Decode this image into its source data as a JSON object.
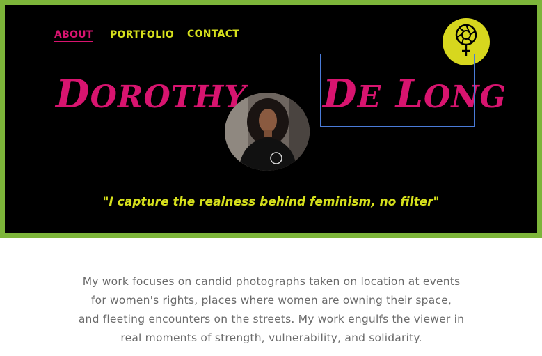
{
  "nav": {
    "about": "ABOUT",
    "portfolio": "PORTFOLIO",
    "contact": "CONTACT"
  },
  "hero": {
    "first_name_initial": "D",
    "first_name_rest": "OROTHY",
    "last_name_part1_initial": "D",
    "last_name_part1_rest": "E",
    "last_name_part2_initial": "L",
    "last_name_part2_rest": "ONG",
    "tagline": "\"I capture the realness behind feminism, no  filter\""
  },
  "logo": {
    "icon": "camera-aperture-venus-icon"
  },
  "intro": {
    "lines": [
      "My work focuses on candid photographs taken on location at events",
      "for women's rights, places where women are owning their space,",
      "and fleeting encounters on the streets.  My work engulfs the viewer in",
      "real moments of strength, vulnerability, and solidarity."
    ]
  },
  "colors": {
    "hero_bg": "#000000",
    "border": "#7db53a",
    "accent_pink": "#d8146f",
    "accent_yellow": "#d6e01c",
    "body_text": "#6b6b6b"
  }
}
